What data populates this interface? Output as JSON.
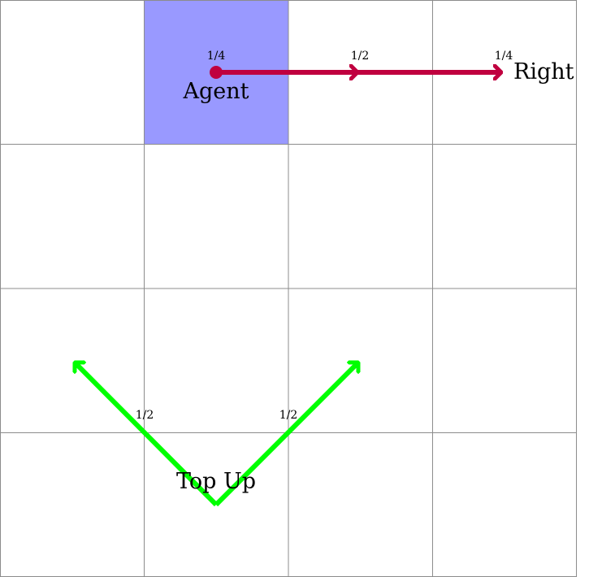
{
  "colors": {
    "grid": "#8c8c8c",
    "agent_cell": "#9999ff",
    "right_action": "#c0003f",
    "top_up_action": "#00ff00"
  },
  "agent": {
    "label": "Agent",
    "probability": "1/4"
  },
  "right_action": {
    "label": "Right",
    "probability_mid": "1/2",
    "probability_end": "1/4"
  },
  "top_up_action": {
    "label": "Top Up",
    "probability_left": "1/2",
    "probability_right": "1/2"
  }
}
